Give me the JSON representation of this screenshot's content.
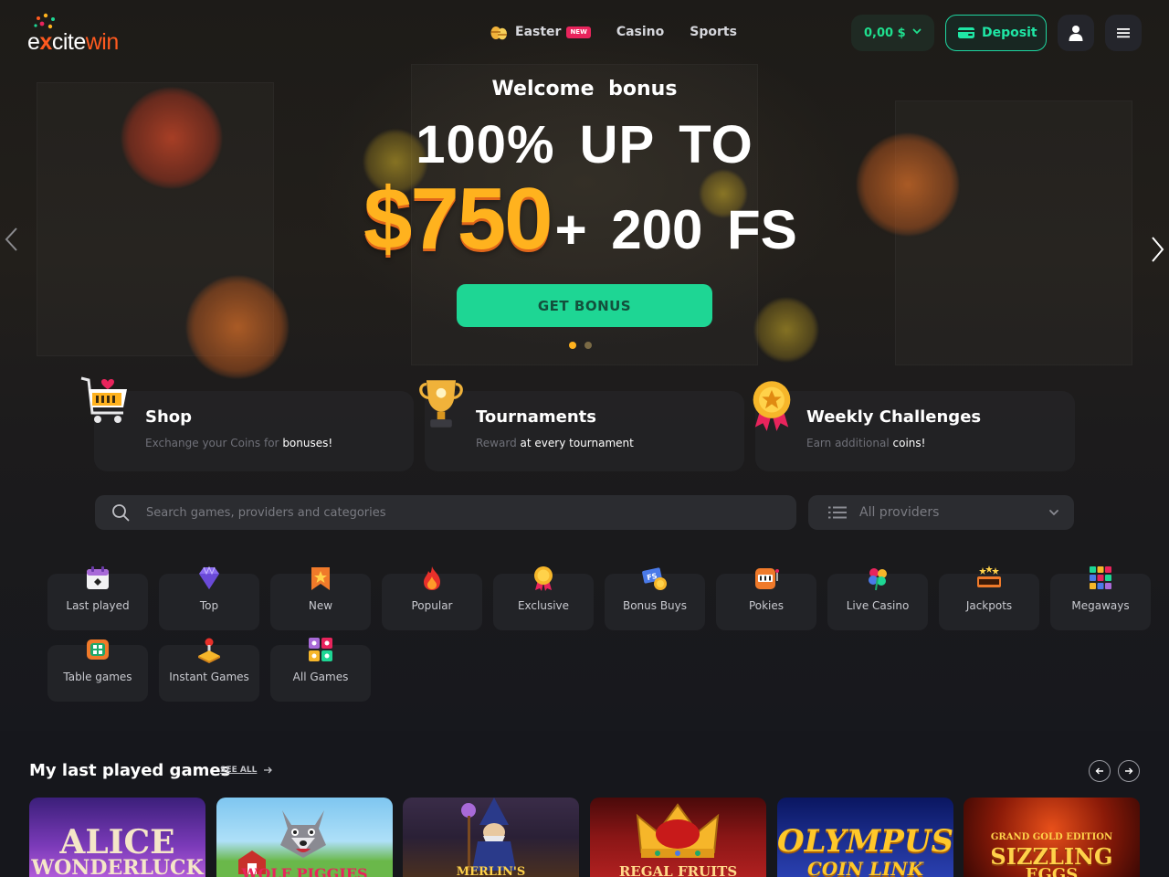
{
  "brand": {
    "logo_text_1": "e",
    "logo_text_x": "x",
    "logo_text_2": "cite",
    "logo_text_win": "win"
  },
  "nav": [
    {
      "label": "Easter",
      "badge": "NEW",
      "icon": "easter-eggs-icon"
    },
    {
      "label": "Casino"
    },
    {
      "label": "Sports"
    }
  ],
  "header": {
    "balance": "0,00 $",
    "deposit_label": "Deposit",
    "profile_icon": "user-icon",
    "menu_icon": "hamburger-icon"
  },
  "hero": {
    "subtitle": "Welcome bonus",
    "line1": "100% UP TO",
    "amount": "$750",
    "extra": "+ 200 FS",
    "cta": "GET BONUS",
    "slide_count": 2,
    "active_slide": 1
  },
  "promos": [
    {
      "title": "Shop",
      "desc_muted": "Exchange your Coins for",
      "desc_bold": "bonuses!",
      "icon": "shopping-cart-icon"
    },
    {
      "title": "Tournaments",
      "desc_muted": "Reward",
      "desc_bold": "at every tournament",
      "icon": "trophy-icon"
    },
    {
      "title": "Weekly Challenges",
      "desc_muted": "Earn additional",
      "desc_bold": "coins!",
      "icon": "medal-icon"
    }
  ],
  "search": {
    "placeholder": "Search games, providers and categories"
  },
  "providers": {
    "label": "All providers"
  },
  "categories": [
    {
      "label": "Last played",
      "icon": "calendar-icon"
    },
    {
      "label": "Top",
      "icon": "diamond-icon"
    },
    {
      "label": "New",
      "icon": "bookmark-star-icon"
    },
    {
      "label": "Popular",
      "icon": "fire-icon"
    },
    {
      "label": "Exclusive",
      "icon": "medal-icon"
    },
    {
      "label": "Bonus Buys",
      "icon": "free-spins-icon"
    },
    {
      "label": "Pokies",
      "icon": "slot-machine-icon"
    },
    {
      "label": "Live Casino",
      "icon": "clover-icon"
    },
    {
      "label": "Jackpots",
      "icon": "jackpot-icon"
    },
    {
      "label": "Megaways",
      "icon": "megaways-icon"
    },
    {
      "label": "Table games",
      "icon": "table-icon"
    },
    {
      "label": "Instant Games",
      "icon": "joystick-icon"
    },
    {
      "label": "All Games",
      "icon": "all-games-icon"
    }
  ],
  "last_played": {
    "title": "My last played games",
    "see_all": "SEE ALL",
    "games": [
      {
        "name_1": "ALICE",
        "name_2": "WONDERLUCK",
        "color": "#6a3aa8"
      },
      {
        "name_1": "WOLF",
        "name_2": "PIGGIES",
        "color": "#5aa4e0"
      },
      {
        "name_1": "",
        "name_2": "MERLIN'S",
        "color": "#2a2440"
      },
      {
        "name_1": "",
        "name_2": "REGAL FRUITS",
        "color": "#7a1414"
      },
      {
        "name_1": "OLYMPUS",
        "name_2": "COIN LINK",
        "color": "#1b2d8c"
      },
      {
        "name_1": "GRAND GOLD EDITION",
        "name_2": "SIZZLING",
        "name_3": "EGGS",
        "color": "#5a1208"
      }
    ]
  },
  "colors": {
    "accent_green": "#1ed694",
    "amount_orange": "#ffb21e",
    "brand_orange": "#ff5a1f"
  }
}
